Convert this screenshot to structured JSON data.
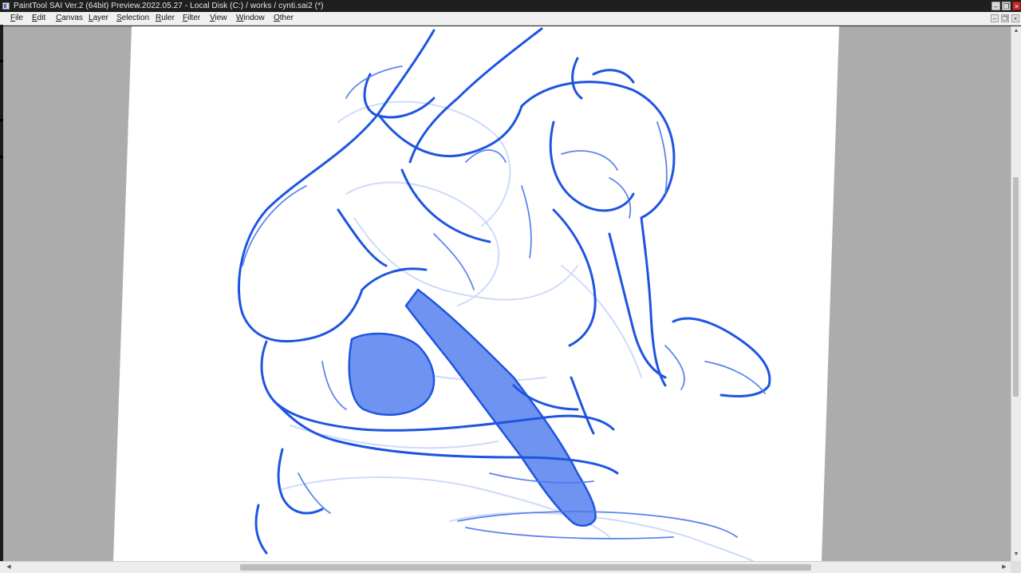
{
  "window": {
    "title": "PaintTool SAI Ver.2 (64bit) Preview.2022.05.27 - Local Disk (C:) / works / cynti.sai2 (*)",
    "controls": [
      "minimize",
      "restore",
      "close"
    ]
  },
  "menu": {
    "items": [
      {
        "label": "File",
        "ul": "F",
        "rest": "ile"
      },
      {
        "label": "Edit",
        "ul": "E",
        "rest": "dit"
      },
      {
        "label": "Canvas",
        "ul": "C",
        "rest": "anvas"
      },
      {
        "label": "Layer",
        "ul": "L",
        "rest": "ayer"
      },
      {
        "label": "Selection",
        "ul": "S",
        "rest": "election"
      },
      {
        "label": "Ruler",
        "ul": "R",
        "rest": "uler"
      },
      {
        "label": "Filter",
        "ul": "F",
        "rest": "ilter"
      },
      {
        "label": "View",
        "ul": "V",
        "rest": "iew"
      },
      {
        "label": "Window",
        "ul": "W",
        "rest": "indow"
      },
      {
        "label": "Other",
        "ul": "O",
        "rest": "ther"
      }
    ]
  },
  "canvas": {
    "document": "cynti.sai2",
    "content": "blue pencil gesture sketch of a crouching figure",
    "stroke_color": "#1e55e0",
    "fill_color": "#6f93f0",
    "paper_color": "#ffffff",
    "backdrop_color": "#acacac"
  },
  "scrollbars": {
    "vertical": "scrollbar",
    "horizontal": "scrollbar"
  }
}
